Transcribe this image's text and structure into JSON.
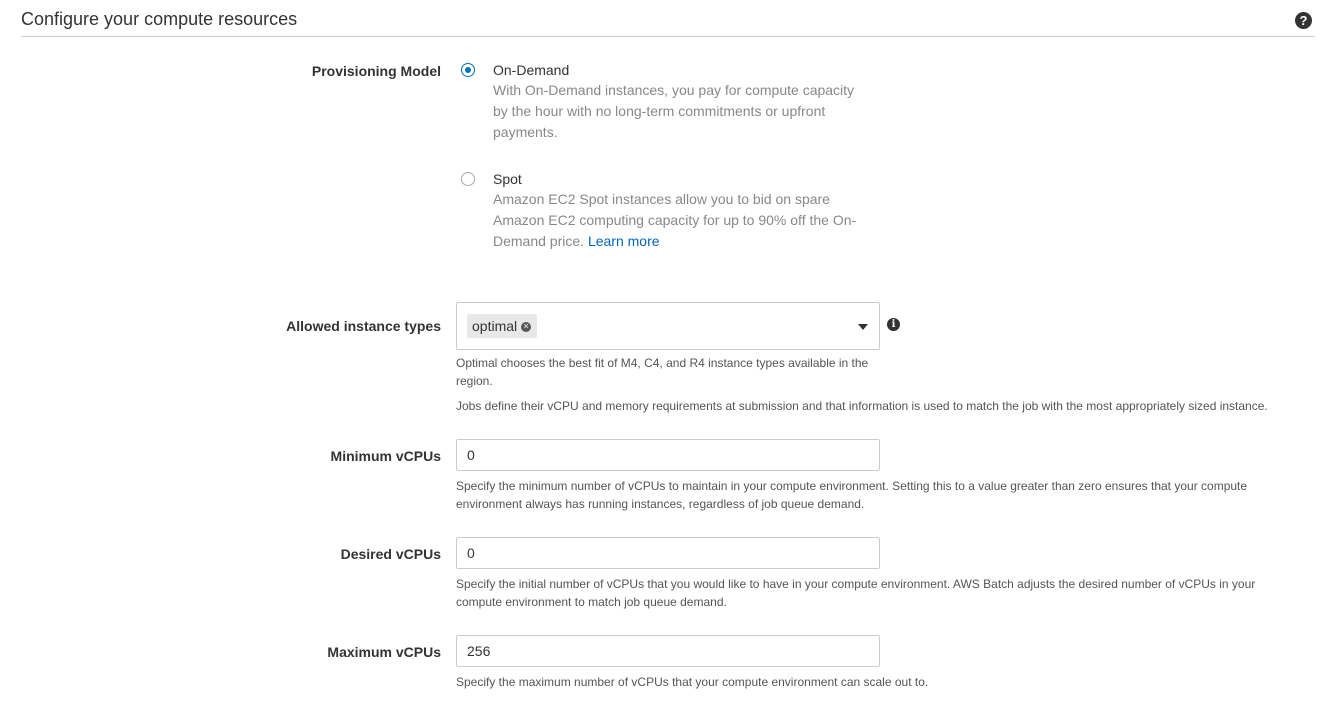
{
  "section": {
    "title": "Configure your compute resources",
    "help_icon": "question-circle-icon"
  },
  "provisioning": {
    "label": "Provisioning Model",
    "options": [
      {
        "label": "On-Demand",
        "selected": true,
        "desc_lines": [
          "With On-Demand instances, you pay for compute capacity",
          "by the hour with no long-term commitments or upfront",
          "payments."
        ]
      },
      {
        "label": "Spot",
        "selected": false,
        "desc_lines": [
          "Amazon EC2 Spot instances allow you to bid on spare",
          "Amazon EC2 computing capacity for up to 90% off the On-",
          "Demand price."
        ],
        "link": "Learn more"
      }
    ]
  },
  "instance_types": {
    "label": "Allowed instance types",
    "token": "optimal",
    "info_icon": "info-circle-icon",
    "hint_lines": [
      "Optimal chooses the best fit of M4, C4, and R4 instance types available in the",
      "region."
    ],
    "hint2": "Jobs define their vCPU and memory requirements at submission and that information is used to match the job with the most appropriately sized instance."
  },
  "min_vcpus": {
    "label": "Minimum vCPUs",
    "value": "0",
    "hint_lines": [
      "Specify the minimum number of vCPUs to maintain in your compute environment. Setting this to a value greater than zero ensures that your compute",
      "environment always has running instances, regardless of job queue demand."
    ]
  },
  "desired_vcpus": {
    "label": "Desired vCPUs",
    "value": "0",
    "hint_lines": [
      "Specify the initial number of vCPUs that you would like to have in your compute environment. AWS Batch adjusts the desired number of vCPUs in your",
      "compute environment to match job queue demand."
    ]
  },
  "max_vcpus": {
    "label": "Maximum vCPUs",
    "value": "256",
    "hint": "Specify the maximum number of vCPUs that your compute environment can scale out to."
  },
  "colors": {
    "accent": "#0073bb",
    "link": "#0066c0",
    "muted_text": "#888888"
  }
}
